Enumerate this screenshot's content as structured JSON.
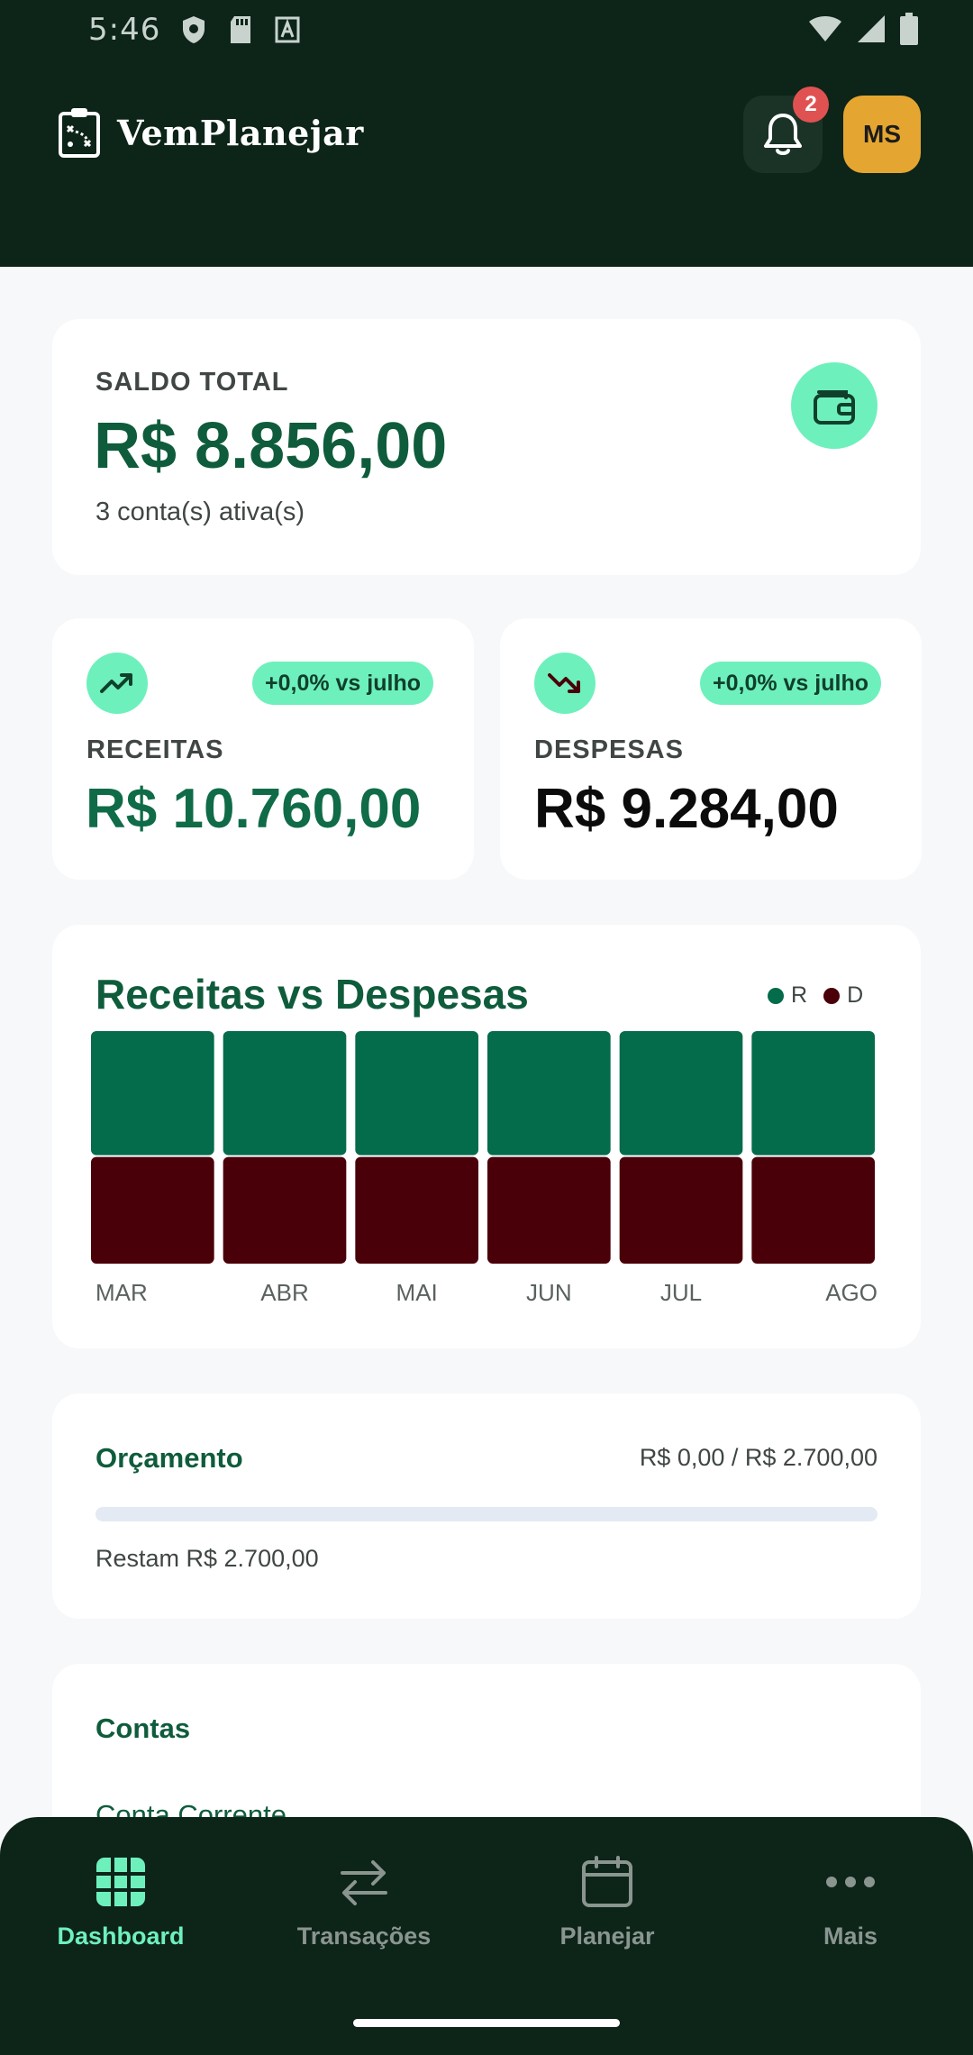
{
  "status_bar": {
    "time": "5:46"
  },
  "header": {
    "brand": "VemPlanejar",
    "notification_count": "2",
    "avatar_initials": "MS"
  },
  "balance": {
    "label": "SALDO TOTAL",
    "value": "R$ 8.856,00",
    "accounts": "3 conta(s) ativa(s)"
  },
  "income": {
    "change": "+0,0% vs julho",
    "label": "RECEITAS",
    "value": "R$ 10.760,00"
  },
  "expenses": {
    "change": "+0,0% vs julho",
    "label": "DESPESAS",
    "value": "R$ 9.284,00"
  },
  "chart": {
    "title": "Receitas vs Despesas",
    "legend_r": "R",
    "legend_d": "D"
  },
  "chart_data": {
    "type": "bar",
    "title": "Receitas vs Despesas",
    "categories": [
      "MAR",
      "ABR",
      "MAI",
      "JUN",
      "JUL",
      "AGO"
    ],
    "series": [
      {
        "name": "R",
        "values": [
          10760,
          10760,
          10760,
          10760,
          10760,
          10760
        ],
        "color": "#046b4b"
      },
      {
        "name": "D",
        "values": [
          9284,
          9284,
          9284,
          9284,
          9284,
          9284
        ],
        "color": "#4a0008"
      }
    ],
    "stacked": true,
    "grid": false,
    "legend": "top-right"
  },
  "budget": {
    "title": "Orçamento",
    "summary": "R$ 0,00 / R$ 2.700,00",
    "progress": 0,
    "remaining": "Restam R$ 2.700,00"
  },
  "accounts_card": {
    "title": "Contas",
    "first_account": "Conta Corrente"
  },
  "nav": {
    "items": [
      {
        "label": "Dashboard",
        "icon": "grid-icon",
        "active": true
      },
      {
        "label": "Transações",
        "icon": "swap-arrows-icon",
        "active": false
      },
      {
        "label": "Planejar",
        "icon": "calendar-icon",
        "active": false
      },
      {
        "label": "Mais",
        "icon": "more-dots-icon",
        "active": false
      }
    ]
  },
  "colors": {
    "header_bg": "#0d2419",
    "accent_green": "#0f5c3c",
    "mint": "#6ef0bd",
    "income_bar": "#046b4b",
    "expense_bar": "#4a0008",
    "avatar_bg": "#e5a631"
  }
}
